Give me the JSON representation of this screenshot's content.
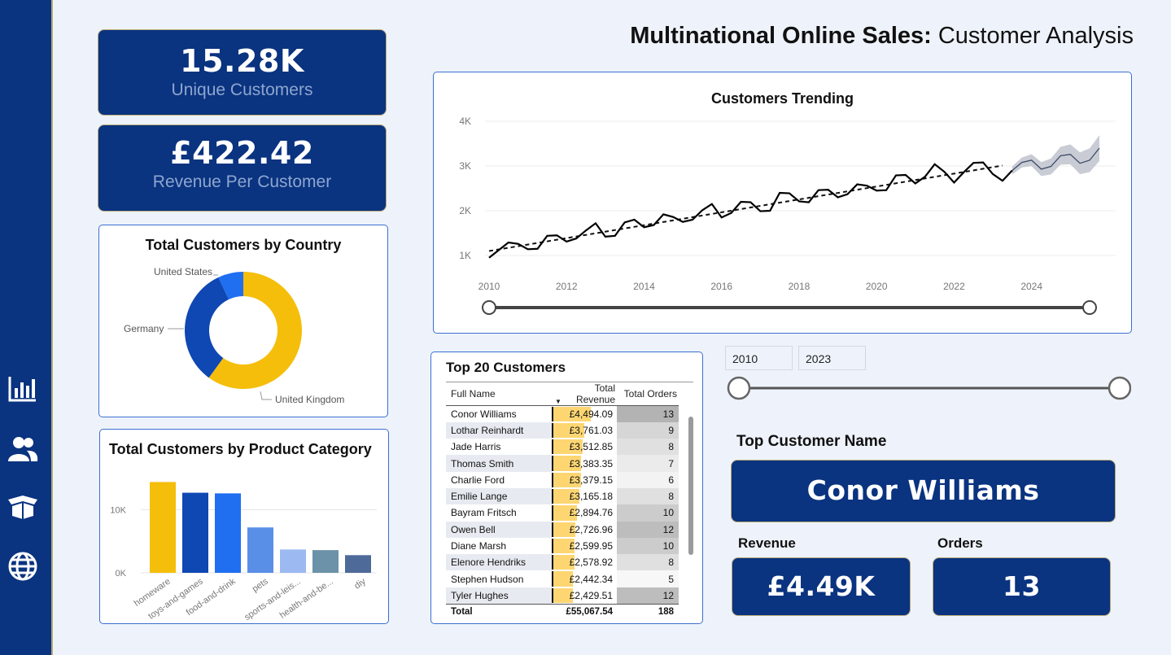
{
  "page_title": {
    "bold": "Multinational Online Sales:",
    "rest": " Customer Analysis"
  },
  "kpis": {
    "unique_customers": {
      "value": "15.28K",
      "label": "Unique Customers"
    },
    "revenue_per_customer": {
      "value": "£422.42",
      "label": "Revenue Per Customer"
    }
  },
  "nav": [
    "bar-chart-icon",
    "users-icon",
    "box-icon",
    "globe-icon"
  ],
  "country_chart": {
    "title": "Total Customers by Country",
    "chart_data": {
      "type": "pie",
      "categories": [
        "United Kingdom",
        "Germany",
        "United States"
      ],
      "values": [
        60,
        33,
        7
      ],
      "colors": [
        "#f5be0b",
        "#0f47b3",
        "#1f6ff0"
      ]
    }
  },
  "trend_chart": {
    "title": "Customers Trending",
    "y_ticks": [
      "4K",
      "3K",
      "2K",
      "1K"
    ],
    "x_ticks": [
      "2010",
      "2012",
      "2014",
      "2016",
      "2018",
      "2020",
      "2022",
      "2024"
    ]
  },
  "category_chart": {
    "title": "Total Customers by Product Category",
    "y_ticks": [
      "10K",
      "0K"
    ],
    "chart_data": {
      "type": "bar",
      "categories": [
        "homeware",
        "toys-and-games",
        "food-and-drink",
        "pets",
        "sports-and-leis...",
        "health-and-be...",
        "diy"
      ],
      "values": [
        14400,
        12700,
        12600,
        7200,
        3700,
        3600,
        2800
      ],
      "colors": [
        "#f5be0b",
        "#0f47b3",
        "#1f6ff0",
        "#5a8fe8",
        "#9cb9f2",
        "#6b92a8",
        "#4e6a99"
      ],
      "ylim": [
        0,
        16000
      ]
    }
  },
  "chart_data": [
    {
      "type": "line",
      "title": "Customers Trending",
      "x": [
        2010.0,
        2010.25,
        2010.5,
        2010.75,
        2011.0,
        2011.25,
        2011.5,
        2011.75,
        2012.0,
        2012.25,
        2012.5,
        2012.75,
        2013.0,
        2013.25,
        2013.5,
        2013.75,
        2014.0,
        2014.25,
        2014.5,
        2014.75,
        2015.0,
        2015.25,
        2015.5,
        2015.75,
        2016.0,
        2016.25,
        2016.5,
        2016.75,
        2017.0,
        2017.25,
        2017.5,
        2017.75,
        2018.0,
        2018.25,
        2018.5,
        2018.75,
        2019.0,
        2019.25,
        2019.5,
        2019.75,
        2020.0,
        2020.25,
        2020.5,
        2020.75,
        2021.0,
        2021.25,
        2021.5,
        2021.75,
        2022.0,
        2022.25,
        2022.5,
        2022.75,
        2023.0,
        2023.25,
        2023.5
      ],
      "y": [
        950,
        1120,
        1290,
        1260,
        1140,
        1150,
        1440,
        1450,
        1310,
        1380,
        1560,
        1720,
        1420,
        1440,
        1740,
        1800,
        1630,
        1680,
        1920,
        1860,
        1750,
        1800,
        2010,
        2150,
        1850,
        1950,
        2200,
        2190,
        1990,
        2000,
        2400,
        2390,
        2210,
        2190,
        2460,
        2470,
        2300,
        2370,
        2590,
        2560,
        2450,
        2460,
        2790,
        2800,
        2610,
        2760,
        3040,
        2870,
        2630,
        2860,
        3070,
        3080,
        2820,
        2670,
        2900
      ],
      "forecast_x": [
        2023.5,
        2023.75,
        2024.0,
        2024.25,
        2024.5,
        2024.75,
        2025.0,
        2025.25,
        2025.5,
        2025.75
      ],
      "forecast_y": [
        2900,
        3080,
        3130,
        2930,
        2990,
        3230,
        3260,
        3060,
        3130,
        3400
      ],
      "trend": {
        "from": [
          2010.0,
          1100
        ],
        "to": [
          2023.25,
          3010
        ]
      },
      "ylim": [
        500,
        4200
      ],
      "xlim": [
        2010,
        2026
      ]
    }
  ],
  "slider": {
    "from": "2010",
    "to": "2023"
  },
  "top_customers": {
    "title": "Top 20 Customers",
    "columns": [
      "Full Name",
      "Total Revenue",
      "Total Orders"
    ],
    "rows": [
      {
        "name": "Conor Williams",
        "rev": "£4,494.09",
        "rv": 4494.09,
        "orders": "13",
        "shade": "#b3b3b3"
      },
      {
        "name": "Lothar Reinhardt",
        "rev": "£3,761.03",
        "rv": 3761.03,
        "orders": "9",
        "shade": "#d6d6d6"
      },
      {
        "name": "Jade Harris",
        "rev": "£3,512.85",
        "rv": 3512.85,
        "orders": "8",
        "shade": "#e0e0e0"
      },
      {
        "name": "Thomas Smith",
        "rev": "£3,383.35",
        "rv": 3383.35,
        "orders": "7",
        "shade": "#ebebeb"
      },
      {
        "name": "Charlie Ford",
        "rev": "£3,379.15",
        "rv": 3379.15,
        "orders": "6",
        "shade": "#f3f3f3"
      },
      {
        "name": "Emilie Lange",
        "rev": "£3,165.18",
        "rv": 3165.18,
        "orders": "8",
        "shade": "#e0e0e0"
      },
      {
        "name": "Bayram Fritsch",
        "rev": "£2,894.76",
        "rv": 2894.76,
        "orders": "10",
        "shade": "#cccccc"
      },
      {
        "name": "Owen Bell",
        "rev": "£2,726.96",
        "rv": 2726.96,
        "orders": "12",
        "shade": "#bdbdbd"
      },
      {
        "name": "Diane Marsh",
        "rev": "£2,599.95",
        "rv": 2599.95,
        "orders": "10",
        "shade": "#cccccc"
      },
      {
        "name": "Elenore Hendriks",
        "rev": "£2,578.92",
        "rv": 2578.92,
        "orders": "8",
        "shade": "#e0e0e0"
      },
      {
        "name": "Stephen Hudson",
        "rev": "£2,442.34",
        "rv": 2442.34,
        "orders": "5",
        "shade": "#f7f7f7"
      },
      {
        "name": "Tyler Hughes",
        "rev": "£2,429.51",
        "rv": 2429.51,
        "orders": "12",
        "shade": "#bdbdbd"
      }
    ],
    "total": {
      "label": "Total",
      "rev": "£55,067.54",
      "orders": "188"
    }
  },
  "top_customer": {
    "title": "Top Customer Name",
    "name": "Conor Williams",
    "revenue_label": "Revenue",
    "revenue": "£4.49K",
    "orders_label": "Orders",
    "orders": "13"
  }
}
